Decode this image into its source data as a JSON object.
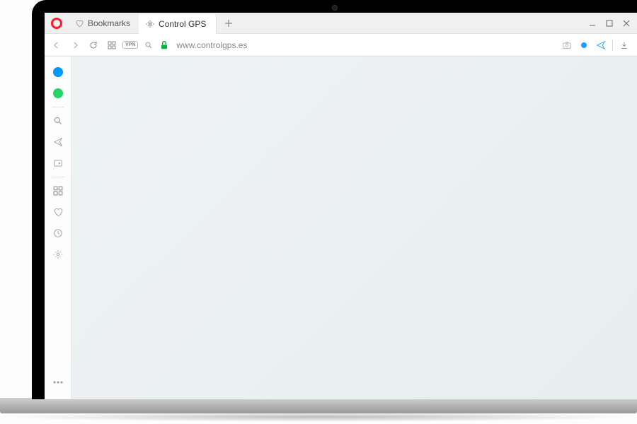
{
  "tabbar": {
    "bookmarks_label": "Bookmarks",
    "active_tab_title": "Control GPS"
  },
  "addressbar": {
    "vpn_label": "VPN",
    "url": "www.controlgps.es"
  },
  "colors": {
    "opera_red": "#ff1b2d",
    "secure_green": "#0db14b",
    "messenger_blue": "#0099ff",
    "whatsapp_green": "#25d366",
    "accent_blue": "#1a9fff"
  }
}
